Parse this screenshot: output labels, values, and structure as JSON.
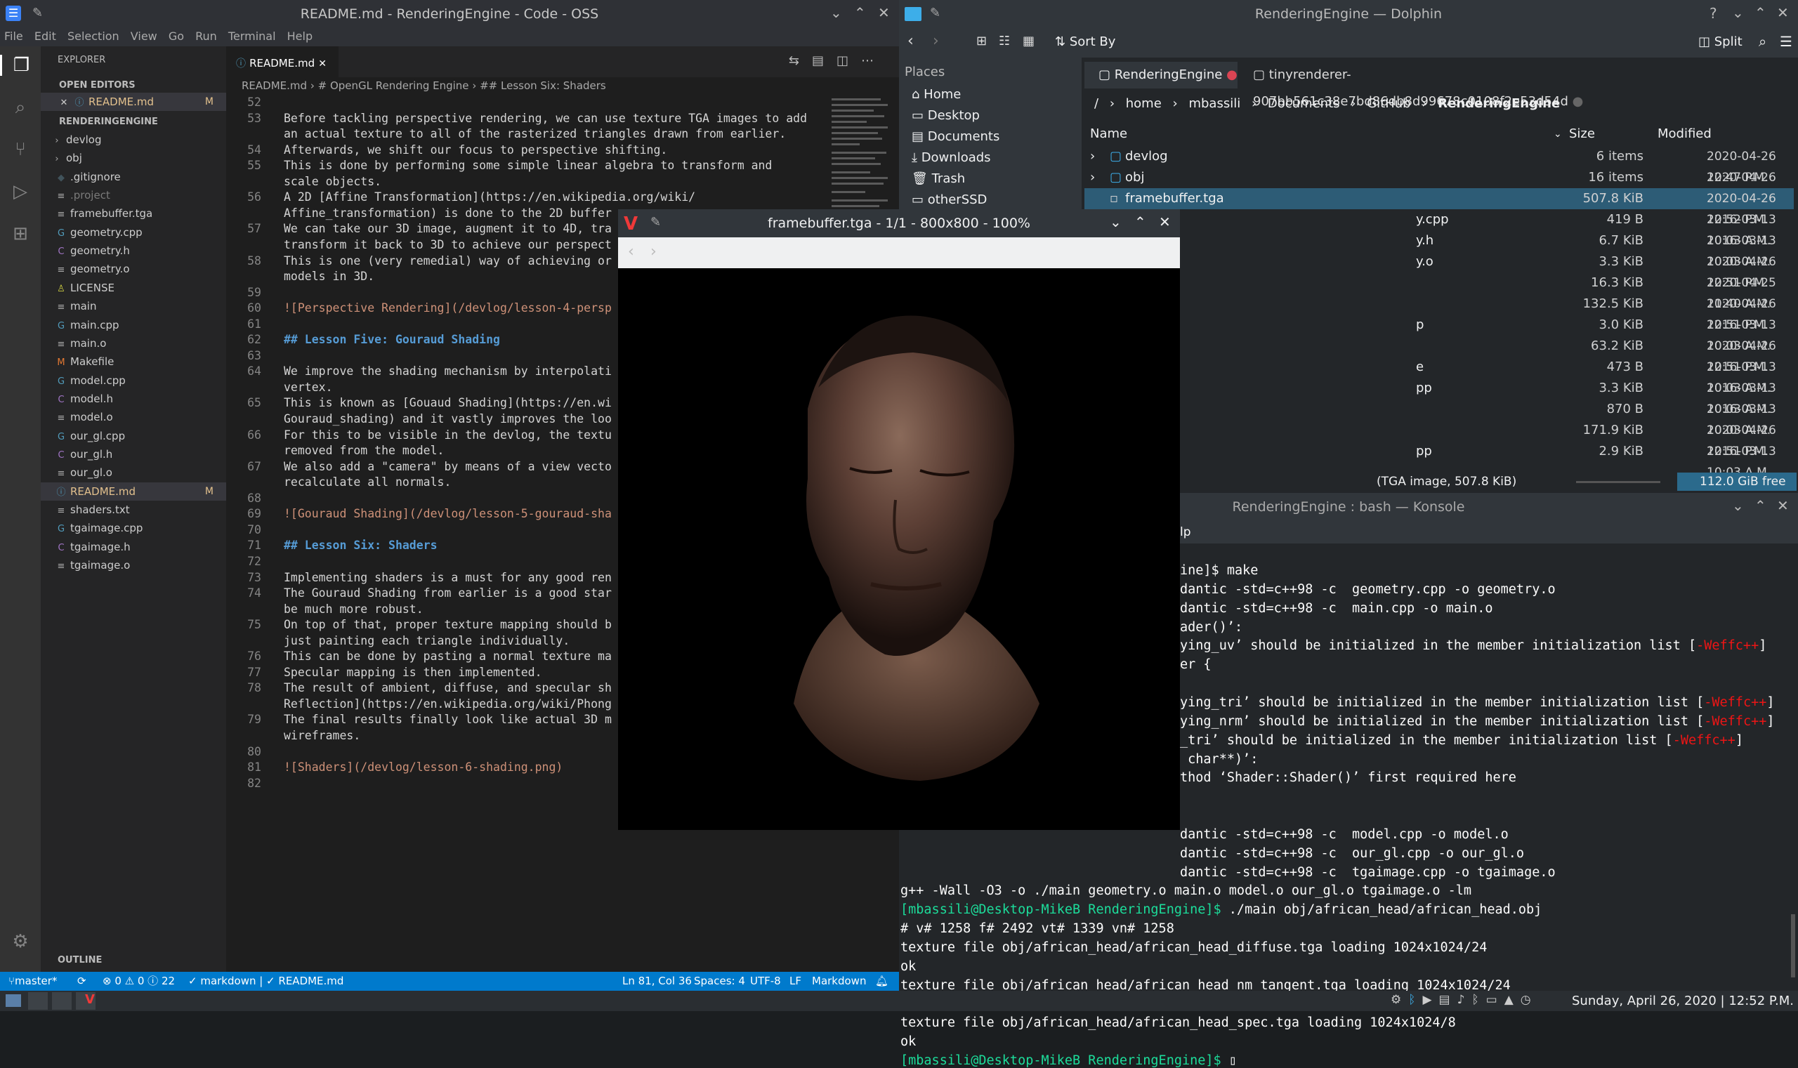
{
  "vscode": {
    "window_title": "README.md - RenderingEngine - Code - OSS",
    "menu": [
      "File",
      "Edit",
      "Selection",
      "View",
      "Go",
      "Run",
      "Terminal",
      "Help"
    ],
    "explorer_label": "EXPLORER",
    "open_editors_label": "OPEN EDITORS",
    "open_editor_file": "README.md",
    "open_editor_badge": "M",
    "project_label": "RENDERINGENGINE",
    "files": [
      {
        "name": "devlog",
        "icon": "›"
      },
      {
        "name": "obj",
        "icon": "›"
      },
      {
        "name": ".gitignore",
        "icon": "◆"
      },
      {
        "name": ".project",
        "icon": "≡"
      },
      {
        "name": "framebuffer.tga",
        "icon": "≡"
      },
      {
        "name": "geometry.cpp",
        "icon": "G"
      },
      {
        "name": "geometry.h",
        "icon": "C"
      },
      {
        "name": "geometry.o",
        "icon": "≡"
      },
      {
        "name": "LICENSE",
        "icon": "♙"
      },
      {
        "name": "main",
        "icon": "≡"
      },
      {
        "name": "main.cpp",
        "icon": "G"
      },
      {
        "name": "main.o",
        "icon": "≡"
      },
      {
        "name": "Makefile",
        "icon": "M"
      },
      {
        "name": "model.cpp",
        "icon": "G"
      },
      {
        "name": "model.h",
        "icon": "C"
      },
      {
        "name": "model.o",
        "icon": "≡"
      },
      {
        "name": "our_gl.cpp",
        "icon": "G"
      },
      {
        "name": "our_gl.h",
        "icon": "C"
      },
      {
        "name": "our_gl.o",
        "icon": "≡"
      },
      {
        "name": "README.md",
        "icon": "ⓘ"
      },
      {
        "name": "shaders.txt",
        "icon": "≡"
      },
      {
        "name": "tgaimage.cpp",
        "icon": "G"
      },
      {
        "name": "tgaimage.h",
        "icon": "C"
      },
      {
        "name": "tgaimage.o",
        "icon": "≡"
      }
    ],
    "readme_badge": "M",
    "outline_label": "OUTLINE",
    "tab_label": "README.md",
    "breadcrumbs": [
      "README.md",
      "# OpenGL Rendering Engine",
      "## Lesson Six: Shaders"
    ],
    "code_lines": [
      {
        "n": "52",
        "t": "",
        "c": ""
      },
      {
        "n": "53",
        "t": "Before tackling perspective rendering, we can use texture TGA images to add",
        "c": ""
      },
      {
        "n": "",
        "t": "an actual texture to all of the rasterized triangles drawn from earlier.",
        "c": ""
      },
      {
        "n": "54",
        "t": "Afterwards, we shift our focus to perspective shifting.",
        "c": ""
      },
      {
        "n": "55",
        "t": "This is done by performing some simple linear algebra to transform and",
        "c": ""
      },
      {
        "n": "",
        "t": "scale objects.",
        "c": ""
      },
      {
        "n": "56",
        "t": "A 2D [Affine Transformation](https://en.wikipedia.org/wiki/",
        "c": ""
      },
      {
        "n": "",
        "t": "Affine_transformation) is done to the 2D buffer",
        "c": ""
      },
      {
        "n": "57",
        "t": "We can take our 3D image, augment it to 4D, tra",
        "c": ""
      },
      {
        "n": "",
        "t": "transform it back to 3D to achieve our perspect",
        "c": ""
      },
      {
        "n": "58",
        "t": "This is one (very remedial) way of achieving or",
        "c": ""
      },
      {
        "n": "",
        "t": "models in 3D.",
        "c": ""
      },
      {
        "n": "59",
        "t": "",
        "c": ""
      },
      {
        "n": "60",
        "t": "![Perspective Rendering](/devlog/lesson-4-persp",
        "c": "lk"
      },
      {
        "n": "61",
        "t": "",
        "c": ""
      },
      {
        "n": "62",
        "t": "## Lesson Five: Gouraud Shading",
        "c": "h"
      },
      {
        "n": "63",
        "t": "",
        "c": ""
      },
      {
        "n": "64",
        "t": "We improve the shading mechanism by interpolati",
        "c": ""
      },
      {
        "n": "",
        "t": "vertex.",
        "c": ""
      },
      {
        "n": "65",
        "t": "This is known as [Gouaud Shading](https://en.wi",
        "c": ""
      },
      {
        "n": "",
        "t": "Gouraud_shading) and it vastly improves the loo",
        "c": ""
      },
      {
        "n": "66",
        "t": "For this to be visible in the devlog, the textu",
        "c": ""
      },
      {
        "n": "",
        "t": "removed from the model.",
        "c": ""
      },
      {
        "n": "67",
        "t": "We also add a \"camera\" by means of a view vecto",
        "c": ""
      },
      {
        "n": "",
        "t": "recalculate all normals.",
        "c": ""
      },
      {
        "n": "68",
        "t": "",
        "c": ""
      },
      {
        "n": "69",
        "t": "![Gouraud Shading](/devlog/lesson-5-gouraud-sha",
        "c": "lk"
      },
      {
        "n": "70",
        "t": "",
        "c": ""
      },
      {
        "n": "71",
        "t": "## Lesson Six: Shaders",
        "c": "h"
      },
      {
        "n": "72",
        "t": "",
        "c": ""
      },
      {
        "n": "73",
        "t": "Implementing shaders is a must for any good ren",
        "c": ""
      },
      {
        "n": "74",
        "t": "The Gouraud Shading from earlier is a good star",
        "c": ""
      },
      {
        "n": "",
        "t": "be much more robust.",
        "c": ""
      },
      {
        "n": "75",
        "t": "On top of that, proper texture mapping should b",
        "c": ""
      },
      {
        "n": "",
        "t": "just painting each triangle individually.",
        "c": ""
      },
      {
        "n": "76",
        "t": "This can be done by pasting a normal texture ma",
        "c": ""
      },
      {
        "n": "77",
        "t": "Specular mapping is then implemented.",
        "c": ""
      },
      {
        "n": "78",
        "t": "The result of ambient, diffuse, and specular sh",
        "c": ""
      },
      {
        "n": "",
        "t": "Reflection](https://en.wikipedia.org/wiki/Phong",
        "c": ""
      },
      {
        "n": "79",
        "t": "The final results finally look like actual 3D m",
        "c": ""
      },
      {
        "n": "",
        "t": "wireframes.",
        "c": ""
      },
      {
        "n": "80",
        "t": "",
        "c": ""
      },
      {
        "n": "81",
        "t": "![Shaders](/devlog/lesson-6-shading.png)",
        "c": "lk"
      },
      {
        "n": "82",
        "t": "",
        "c": ""
      }
    ],
    "status": {
      "branch": "master*",
      "problems": "⊗ 0 ⚠ 0 ⓘ 22",
      "language_mode": "✓ markdown | ✓ README.md",
      "position": "Ln 81, Col 36",
      "spaces": "Spaces: 4",
      "encoding": "UTF-8",
      "eol": "LF",
      "language": "Markdown"
    }
  },
  "dolphin": {
    "window_title": "RenderingEngine — Dolphin",
    "sort_label": "Sort By",
    "split_label": "Split",
    "places_label": "Places",
    "places": [
      "Home",
      "Desktop",
      "Documents",
      "Downloads",
      "Trash",
      "otherSSD"
    ],
    "tabs": [
      "RenderingEngine",
      "tinyrenderer-907bb561c38e7bd86db8d99678c0108f2e53d54d"
    ],
    "breadcrumb": [
      "/",
      "home",
      "mbassili",
      "Documents",
      "GitHub",
      "RenderingEngine"
    ],
    "columns": {
      "name": "Name",
      "size": "Size",
      "modified": "Modified"
    },
    "rows": [
      {
        "name": "devlog",
        "size": "6 items",
        "modified": "2020-04-26 12:47 P.M."
      },
      {
        "name": "obj",
        "size": "16 items",
        "modified": "2020-04-26 12:50 P.M."
      },
      {
        "name": "framebuffer.tga",
        "size": "507.8 KiB",
        "modified": "2020-04-26 12:52 P.M."
      },
      {
        "name": "y.cpp",
        "size": "419 B",
        "modified": "2016-03-13 10:03 A.M."
      },
      {
        "name": "y.h",
        "size": "6.7 KiB",
        "modified": "2016-03-13 10:03 A.M."
      },
      {
        "name": "y.o",
        "size": "3.3 KiB",
        "modified": "2020-04-26 12:51 P.M."
      },
      {
        "name": "",
        "size": "16.3 KiB",
        "modified": "2020-04-25 11:40 A.M."
      },
      {
        "name": "",
        "size": "132.5 KiB",
        "modified": "2020-04-26 12:51 P.M."
      },
      {
        "name": "p",
        "size": "3.0 KiB",
        "modified": "2016-03-13 10:03 A.M."
      },
      {
        "name": "",
        "size": "63.2 KiB",
        "modified": "2020-04-26 12:51 P.M."
      },
      {
        "name": "e",
        "size": "473 B",
        "modified": "2016-03-13 10:03 A.M."
      },
      {
        "name": "pp",
        "size": "3.3 KiB",
        "modified": "2016-03-13 10:03 A.M."
      },
      {
        "name": "",
        "size": "870 B",
        "modified": "2016-03-13 10:03 A.M."
      },
      {
        "name": "",
        "size": "171.9 KiB",
        "modified": "2020-04-26 12:51 P.M."
      },
      {
        "name": "pp",
        "size": "2.9 KiB",
        "modified": "2016-03-13 10:03 A.M."
      }
    ],
    "status_text": "(TGA image, 507.8 KiB)",
    "free_space": "112.0 GiB free"
  },
  "konsole": {
    "window_title": "RenderingEngine : bash — Konsole",
    "menu_fragment": "lp",
    "lines": [
      {
        "a": "ine]$ make",
        "p": ""
      },
      {
        "a": "dantic -std=c++98 -c  geometry.cpp -o geometry.o",
        "p": ""
      },
      {
        "a": "dantic -std=c++98 -c  main.cpp -o main.o",
        "p": ""
      },
      {
        "a": "ader()’:",
        "p": ""
      },
      {
        "a": "ying_uv’ should be initialized in the member initialization list [",
        "w": "-Weffc++",
        "z": "]"
      },
      {
        "a": "er {",
        "p": ""
      },
      {
        "a": "",
        "p": ""
      },
      {
        "a": "ying_tri’ should be initialized in the member initialization list [",
        "w": "-Weffc++",
        "z": "]"
      },
      {
        "a": "ying_nrm’ should be initialized in the member initialization list [",
        "w": "-Weffc++",
        "z": "]"
      },
      {
        "a": "_tri’ should be initialized in the member initialization list [",
        "w": "-Weffc++",
        "z": "]"
      },
      {
        "a": " char**)’:",
        "p": ""
      },
      {
        "a": "thod ‘Shader::Shader()’ first required here",
        "p": ""
      },
      {
        "a": "",
        "p": ""
      },
      {
        "a": "",
        "p": ""
      },
      {
        "a": "dantic -std=c++98 -c  model.cpp -o model.o",
        "p": ""
      },
      {
        "a": "dantic -std=c++98 -c  our_gl.cpp -o our_gl.o",
        "p": ""
      },
      {
        "a": "dantic -std=c++98 -c  tgaimage.cpp -o tgaimage.o",
        "p": ""
      }
    ],
    "full_lines": [
      {
        "p": "",
        "t": "g++ -Wall -O3 -o ./main geometry.o main.o model.o our_gl.o tgaimage.o -lm"
      },
      {
        "p": "[mbassili@Desktop-MikeB RenderingEngine]$",
        "t": " ./main obj/african_head/african_head.obj"
      },
      {
        "p": "",
        "t": "# v# 1258 f# 2492 vt# 1339 vn# 1258"
      },
      {
        "p": "",
        "t": "texture file obj/african_head/african_head_diffuse.tga loading 1024x1024/24"
      },
      {
        "p": "",
        "t": "ok"
      },
      {
        "p": "",
        "t": "texture file obj/african_head/african_head_nm_tangent.tga loading 1024x1024/24"
      },
      {
        "p": "",
        "t": "ok"
      },
      {
        "p": "",
        "t": "texture file obj/african_head/african_head_spec.tga loading 1024x1024/8"
      },
      {
        "p": "",
        "t": "ok"
      },
      {
        "p": "[mbassili@Desktop-MikeB RenderingEngine]$",
        "t": " ▯"
      }
    ]
  },
  "viewer": {
    "window_title": "framebuffer.tga - 1/1 - 800x800 - 100%"
  },
  "taskbar": {
    "clock": "Sunday, April 26, 2020 | 12:52 P.M."
  },
  "colors": {
    "vs_status": "#007acc",
    "konsole_prompt": "#1cdc9a",
    "warning": "#ed1515",
    "dolphin_selection": "#3daee9"
  }
}
